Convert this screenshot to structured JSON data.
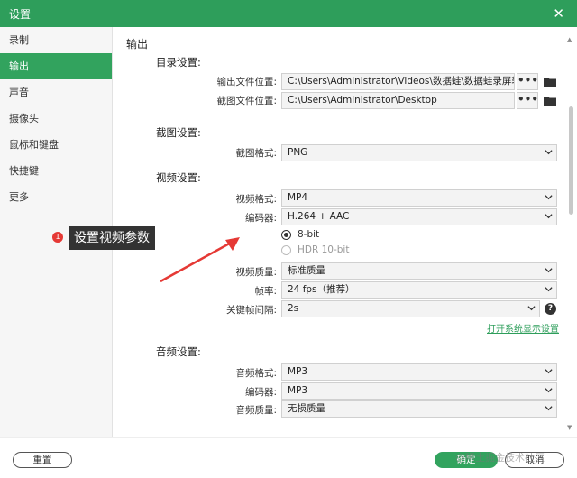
{
  "window": {
    "title": "设置",
    "close_label": "✕"
  },
  "sidebar": {
    "items": [
      {
        "label": "录制"
      },
      {
        "label": "输出"
      },
      {
        "label": "声音"
      },
      {
        "label": "摄像头"
      },
      {
        "label": "鼠标和键盘"
      },
      {
        "label": "快捷键"
      },
      {
        "label": "更多"
      }
    ],
    "active_index": 1
  },
  "main": {
    "section_title": "输出",
    "directory": {
      "title": "目录设置:",
      "output_label": "输出文件位置:",
      "output_value": "C:\\Users\\Administrator\\Videos\\数据蛙\\数据蛙录屏软件",
      "screenshot_label": "截图文件位置:",
      "screenshot_value": "C:\\Users\\Administrator\\Desktop",
      "browse_label": "•••"
    },
    "screenshot": {
      "title": "截图设置:",
      "format_label": "截图格式:",
      "format_value": "PNG"
    },
    "video": {
      "title": "视频设置:",
      "format_label": "视频格式:",
      "format_value": "MP4",
      "encoder_label": "编码器:",
      "encoder_value": "H.264 + AAC",
      "bit_8": "8-bit",
      "bit_hdr": "HDR 10-bit",
      "quality_label": "视频质量:",
      "quality_value": "标准质量",
      "fps_label": "帧率:",
      "fps_value": "24 fps（推荐）",
      "keyframe_label": "关键帧间隔:",
      "keyframe_value": "2s",
      "help_label": "?",
      "display_link": "打开系统显示设置"
    },
    "audio": {
      "title": "音频设置:",
      "format_label": "音频格式:",
      "format_value": "MP3",
      "encoder_label": "编码器:",
      "encoder_value": "MP3",
      "quality_label": "音频质量:",
      "quality_value": "无损质量"
    }
  },
  "footer": {
    "reset_label": "重置",
    "ok_label": "确定",
    "cancel_label": "取消"
  },
  "annotation": {
    "badge": "1",
    "text": "设置视频参数"
  },
  "watermark": "@稀土掘金技术社区",
  "colors": {
    "accent": "#32a35e",
    "titlebar": "#2e9e5b",
    "annotation_red": "#e53935"
  }
}
